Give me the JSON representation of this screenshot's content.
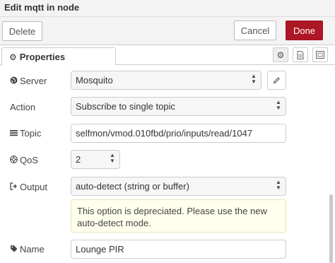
{
  "window": {
    "title": "Edit mqtt in node"
  },
  "toolbar": {
    "delete_label": "Delete",
    "cancel_label": "Cancel",
    "done_label": "Done",
    "done_color": "#ad1625"
  },
  "tabs": {
    "properties_label": "Properties",
    "gear_glyph": "⚙",
    "icons": [
      "gear-icon",
      "description-icon",
      "appearance-icon"
    ]
  },
  "form": {
    "server": {
      "label": "Server",
      "value": "Mosquito",
      "icon": "globe-icon"
    },
    "action": {
      "label": "Action",
      "value": "Subscribe to single topic"
    },
    "topic": {
      "label": "Topic",
      "value": "selfmon/vmod.010fbd/prio/inputs/read/1047",
      "icon": "tasks-icon"
    },
    "qos": {
      "label": "QoS",
      "value": "2",
      "icon": "empire-icon"
    },
    "output": {
      "label": "Output",
      "value": "auto-detect (string or buffer)",
      "icon": "sign-out-icon"
    },
    "tip": "This option is depreciated. Please use the new auto-detect mode.",
    "name": {
      "label": "Name",
      "value": "Lounge PIR",
      "icon": "tag-icon"
    }
  }
}
